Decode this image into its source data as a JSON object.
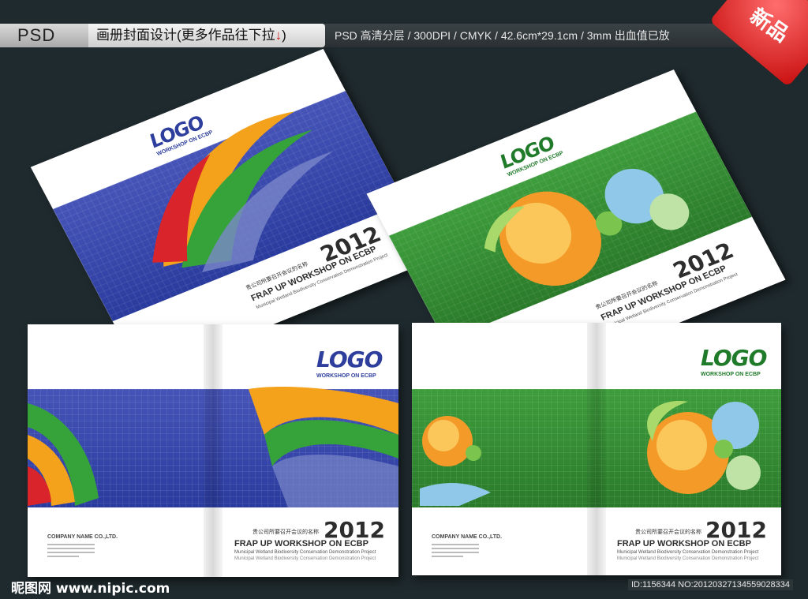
{
  "banner": {
    "psd_label": "PSD",
    "title": "画册封面设计",
    "more": "(更多作品往下拉",
    "arrow": "↓",
    "close_paren": ")",
    "specs": "PSD 高清分层 / 300DPI / CMYK / 42.6cm*29.1cm / 3mm 出血值已放",
    "badge": "新品"
  },
  "cover": {
    "logo": "LOGO",
    "logo_sub": "WORKSHOP ON ECBP",
    "year": "2012",
    "cn_title": "贵公司所要召开会议的名称",
    "tagline": "FRAP UP WORKSHOP ON ECBP",
    "subtitle": "Municipal Wetland Biodiversity Conservation Demonstration Project",
    "subtitle2": "Municipal Wetland Biodiversity Conservation Demonstration Project",
    "company": "COMPANY NAME CO.,LTD."
  },
  "colors": {
    "blue": "#2f3fa3",
    "green": "#2f8a2e",
    "logo_blue": "#2d3e9c",
    "logo_green": "#1f7a2a",
    "badge_red": "#d01515"
  },
  "footer": {
    "site": "昵图网 www.nipic.com",
    "id": "ID:1156344 NO:20120327134559028334"
  }
}
